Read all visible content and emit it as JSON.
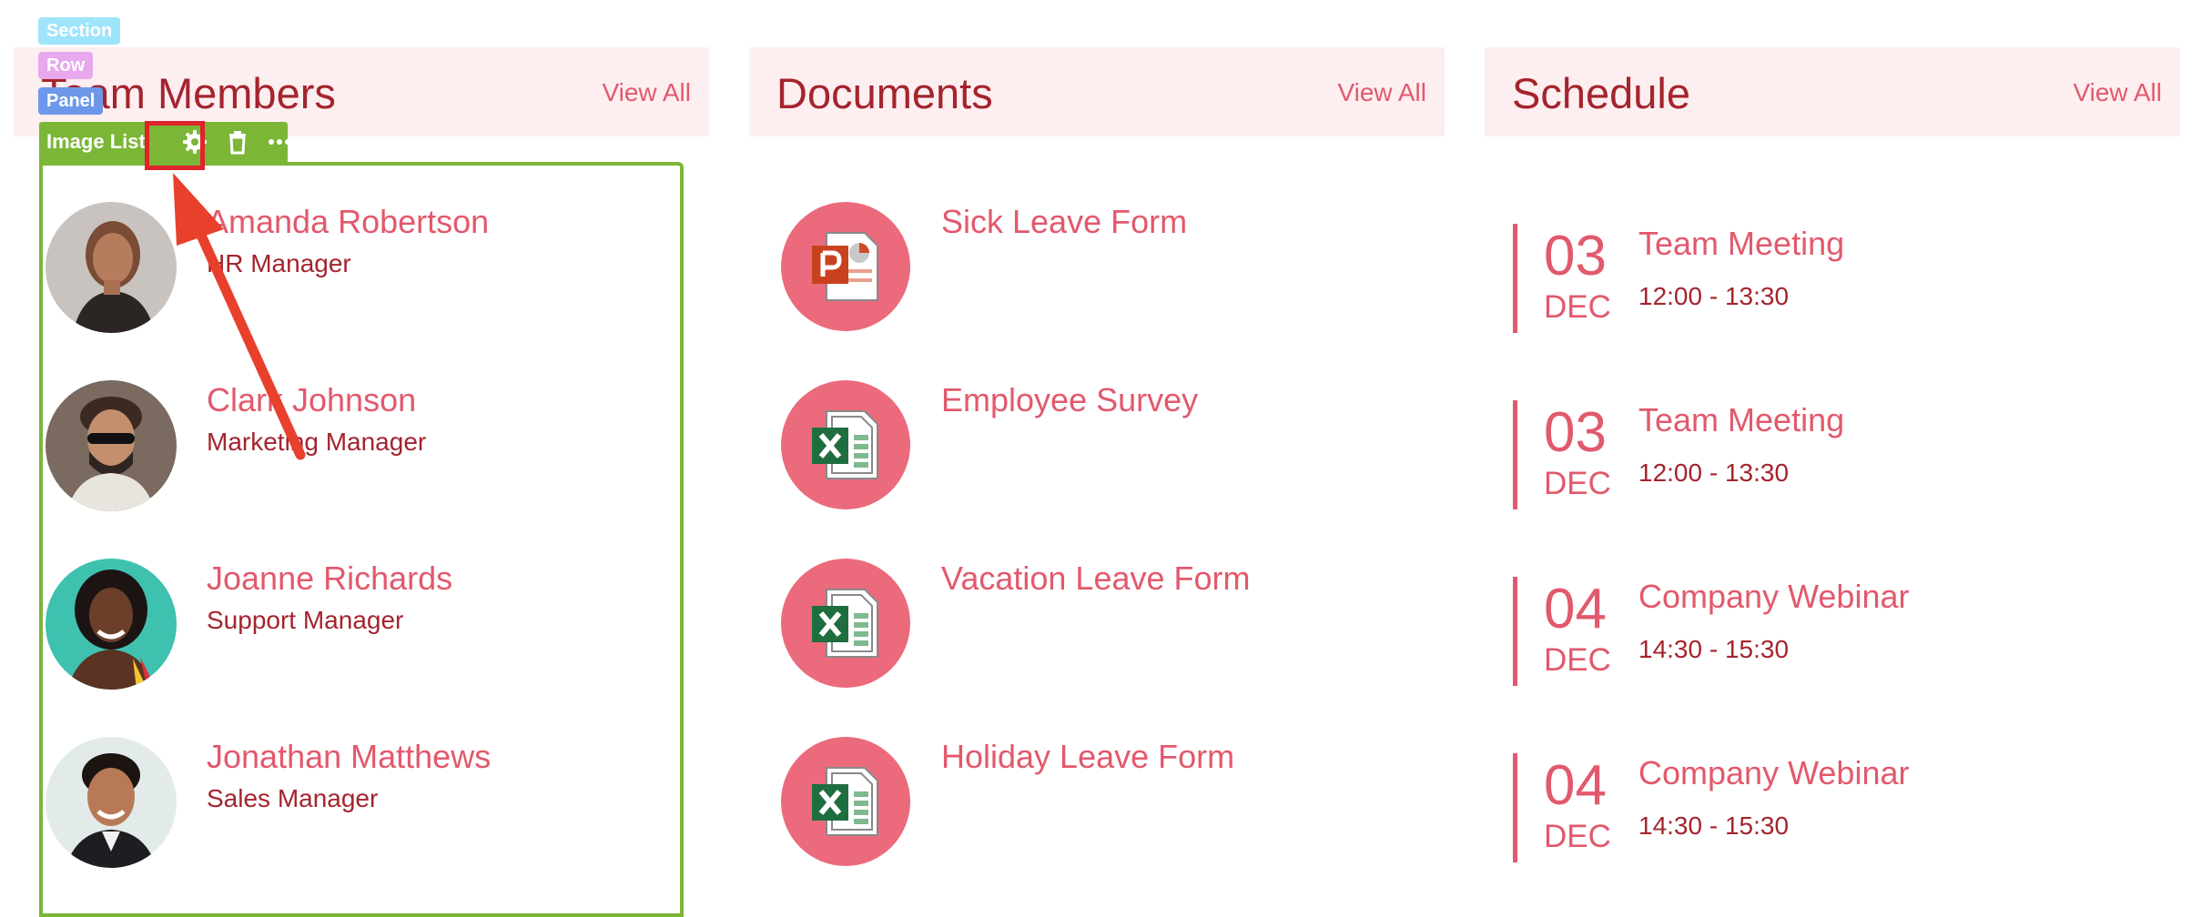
{
  "builder": {
    "section_label": "Section",
    "row_label": "Row",
    "panel_label": "Panel",
    "module_label": "Image List"
  },
  "team": {
    "title": "Team Members",
    "view_all": "View All",
    "members": [
      {
        "name": "Amanda Robertson",
        "role": "HR Manager"
      },
      {
        "name": "Clark Johnson",
        "role": "Marketing Manager"
      },
      {
        "name": "Joanne Richards",
        "role": "Support Manager"
      },
      {
        "name": "Jonathan Matthews",
        "role": "Sales Manager"
      }
    ]
  },
  "documents": {
    "title": "Documents",
    "view_all": "View All",
    "items": [
      {
        "title": "Sick Leave Form",
        "icon": "powerpoint-file-icon"
      },
      {
        "title": "Employee Survey",
        "icon": "excel-file-icon"
      },
      {
        "title": "Vacation Leave Form",
        "icon": "excel-file-icon"
      },
      {
        "title": "Holiday Leave Form",
        "icon": "excel-file-icon"
      }
    ]
  },
  "schedule": {
    "title": "Schedule",
    "view_all": "View All",
    "events": [
      {
        "day": "03",
        "month": "DEC",
        "title": "Team Meeting",
        "time": "12:00 - 13:30"
      },
      {
        "day": "03",
        "month": "DEC",
        "title": "Team Meeting",
        "time": "12:00 - 13:30"
      },
      {
        "day": "04",
        "month": "DEC",
        "title": "Company Webinar",
        "time": "14:30 - 15:30"
      },
      {
        "day": "04",
        "month": "DEC",
        "title": "Company Webinar",
        "time": "14:30 - 15:30"
      }
    ]
  },
  "colors": {
    "header_bg": "#fdeef0",
    "title": "#a4242e",
    "accent": "#e2596c",
    "icon_circle": "#eb6a7c",
    "builder_green": "#7bb637",
    "highlight_red": "#e0232a"
  }
}
